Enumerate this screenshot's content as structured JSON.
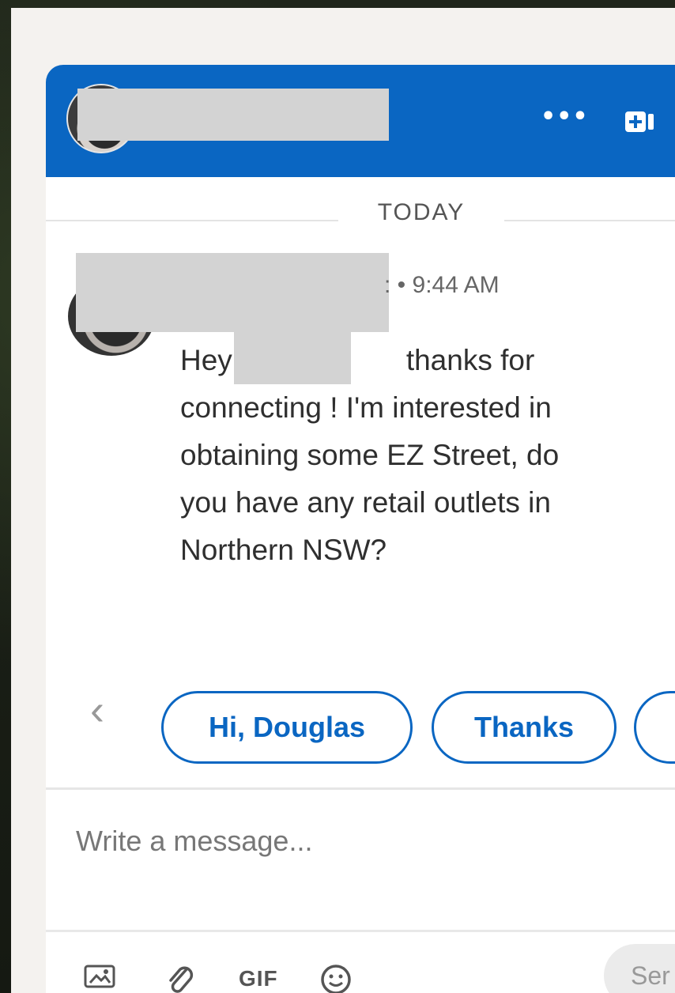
{
  "header": {
    "more_label": "•••",
    "video_icon": "video-call-icon"
  },
  "thread": {
    "date_divider": "TODAY",
    "message_meta": ": • 9:44 AM",
    "message_lines": [
      "Hey",
      "thanks for",
      "connecting ! I'm interested in",
      "obtaining some EZ Street, do",
      "you have any retail outlets in",
      "Northern NSW?"
    ]
  },
  "suggestions": {
    "chips": [
      "Hi, Douglas",
      "Thanks",
      ""
    ]
  },
  "composer": {
    "placeholder": "Write a message...",
    "tools": {
      "image_icon": "image-icon",
      "attach_icon": "paperclip-icon",
      "gif_label": "GIF",
      "emoji_icon": "emoji-icon"
    },
    "send_label": "Ser"
  },
  "colors": {
    "brand": "#0a66c2",
    "redaction": "#d3d3d3"
  }
}
